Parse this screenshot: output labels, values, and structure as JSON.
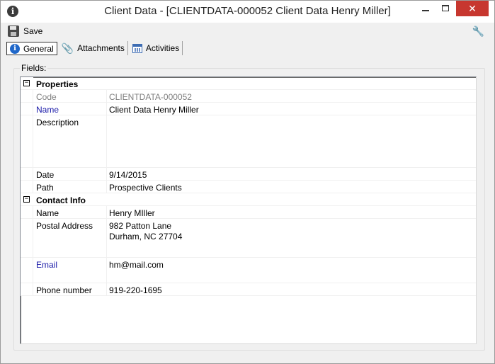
{
  "window": {
    "title": "Client Data - [CLIENTDATA-000052 Client Data Henry Miller]",
    "minimize_label": "",
    "close_label": "✕"
  },
  "toolbar": {
    "save_label": "Save"
  },
  "tabs": [
    {
      "label": "General",
      "icon": "info-icon",
      "active": true
    },
    {
      "label": "Attachments",
      "icon": "paperclip-icon",
      "active": false
    },
    {
      "label": "Activities",
      "icon": "calendar-icon",
      "active": false
    }
  ],
  "fields": {
    "group_label": "Fields:",
    "categories": [
      {
        "label": "Properties",
        "expander": "−",
        "rows": [
          {
            "name": "Code",
            "value": "CLIENTDATA-000052",
            "style": "readonly"
          },
          {
            "name": "Name",
            "value": "Client Data Henry Miller",
            "style": "required"
          },
          {
            "name": "Description",
            "value": "",
            "style": "normal"
          },
          {
            "name": "Date",
            "value": "9/14/2015",
            "style": "normal"
          },
          {
            "name": "Path",
            "value": "Prospective Clients",
            "style": "normal"
          }
        ]
      },
      {
        "label": "Contact Info",
        "expander": "−",
        "rows": [
          {
            "name": "Name",
            "value": "Henry MIller",
            "style": "normal"
          },
          {
            "name": "Postal Address",
            "value_lines": [
              "982 Patton Lane",
              "Durham, NC 27704"
            ],
            "style": "normal"
          },
          {
            "name": "Email",
            "value": "hm@mail.com",
            "style": "required"
          },
          {
            "name": "Phone number",
            "value": "919-220-1695",
            "style": "normal"
          }
        ]
      }
    ]
  },
  "colors": {
    "required_label": "#1a1aa8",
    "readonly_text": "#808080",
    "close_button": "#c7372f",
    "info_icon": "#1f67c9"
  }
}
